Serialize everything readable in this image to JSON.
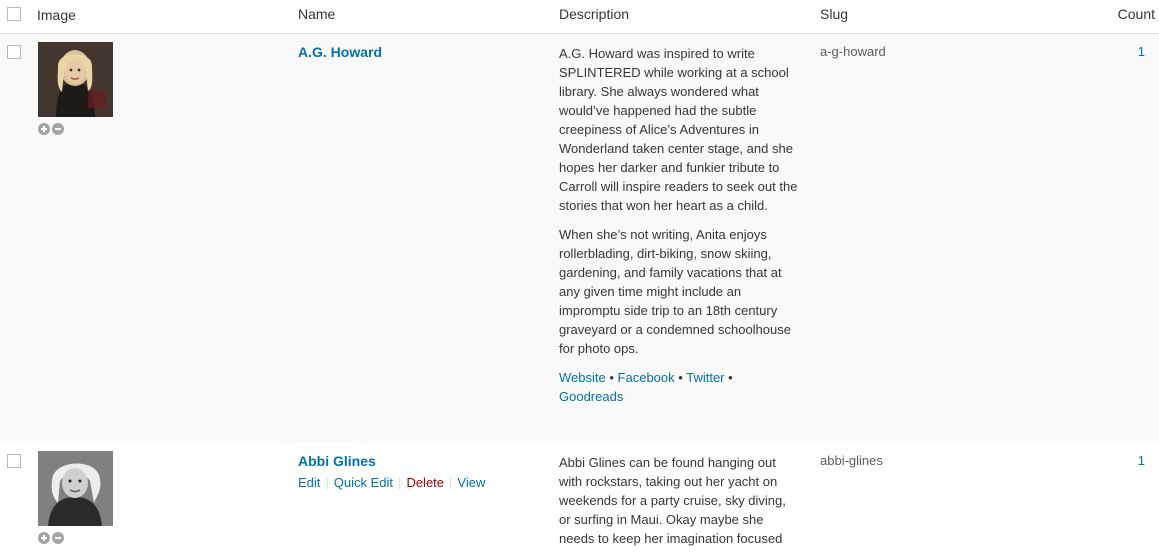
{
  "columns": {
    "image": "Image",
    "name": "Name",
    "description": "Description",
    "slug": "Slug",
    "count": "Count"
  },
  "rows": [
    {
      "name": "A.G. Howard",
      "description_paragraphs": [
        "A.G. Howard was inspired to write SPLINTERED while working at a school library. She always wondered what would’ve happened had the subtle creepiness of Alice’s Adventures in Wonderland taken center stage, and she hopes her darker and funkier tribute to Carroll will inspire readers to seek out the stories that won her heart as a child.",
        "When she’s not writing, Anita enjoys rollerblading, dirt-biking, snow skiing, gardening, and family vacations that at any given time might include an impromptu side trip to an 18th century graveyard or a condemned schoolhouse for photo ops."
      ],
      "links": [
        "Website",
        "Facebook",
        "Twitter",
        "Goodreads"
      ],
      "link_separator": "•",
      "slug": "a-g-howard",
      "count": "1"
    },
    {
      "name": "Abbi Glines",
      "actions": {
        "edit": "Edit",
        "quick_edit": "Quick Edit",
        "delete": "Delete",
        "view": "View",
        "separator": "|"
      },
      "description_paragraphs": [
        "Abbi Glines can be found hanging out with rockstars, taking out her yacht on weekends for a party cruise, sky diving, or surfing in Maui. Okay maybe she needs to keep her imagination focused"
      ],
      "slug": "abbi-glines",
      "count": "1"
    }
  ],
  "icons": {
    "add": "plus-circle-icon",
    "remove": "minus-circle-icon"
  },
  "colors": {
    "link": "#0073aa",
    "delete": "#aa0000",
    "row_alt_bg": "#f9f9f9"
  }
}
